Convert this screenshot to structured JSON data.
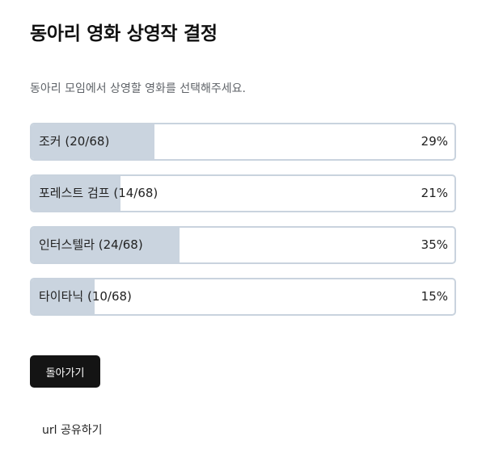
{
  "title": "동아리 영화 상영작 결정",
  "description": "동아리 모임에서 상영할 영화를 선택해주세요.",
  "options": [
    {
      "label": "조커 (20/68)",
      "percent": "29%",
      "fraction": 0.29
    },
    {
      "label": "포레스트 검프 (14/68)",
      "percent": "21%",
      "fraction": 0.21
    },
    {
      "label": "인터스텔라 (24/68)",
      "percent": "35%",
      "fraction": 0.35
    },
    {
      "label": "타이타닉 (10/68)",
      "percent": "15%",
      "fraction": 0.15
    }
  ],
  "back_button": "돌아가기",
  "share_link": "url 공유하기",
  "colors": {
    "fill": "#cad4df",
    "border": "#c9d3de",
    "button_bg": "#141414"
  }
}
